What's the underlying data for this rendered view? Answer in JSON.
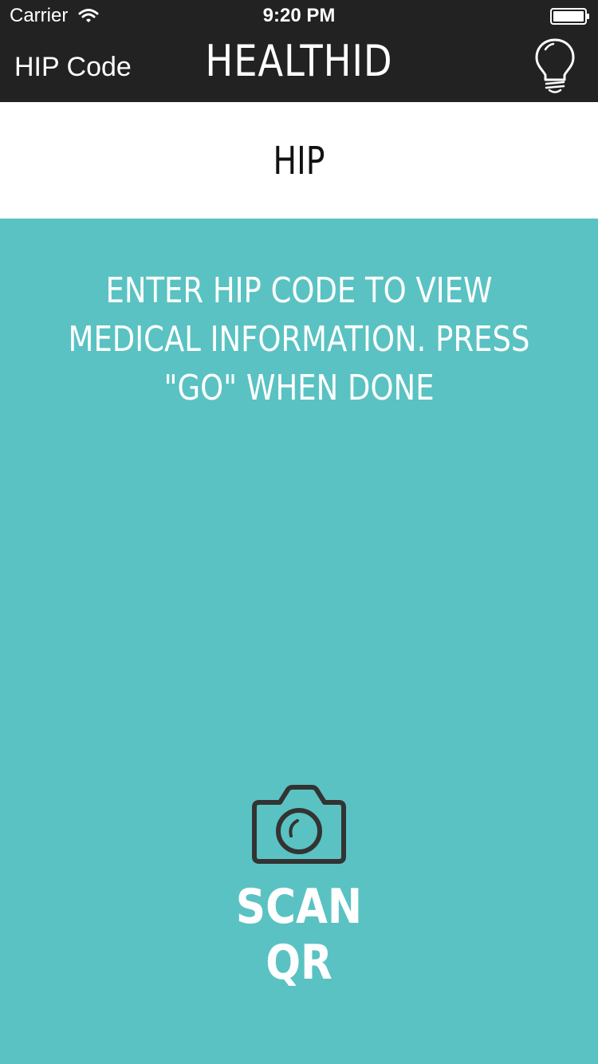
{
  "status_bar": {
    "carrier": "Carrier",
    "time": "9:20 PM",
    "icons": [
      "wifi-icon",
      "battery-icon"
    ]
  },
  "nav_bar": {
    "back_label": "HIP Code",
    "title": "HEALTHID",
    "right_icon": "lightbulb-icon"
  },
  "sub_header": {
    "title": "HIP"
  },
  "main": {
    "instructions": "ENTER HIP CODE TO VIEW MEDICAL INFORMATION. PRESS \"GO\" WHEN DONE",
    "code_input_value": "",
    "scan_icon": "camera-icon",
    "scan_label": "SCAN QR"
  },
  "colors": {
    "bar_background": "#222222",
    "accent_teal": "#5ac2c2",
    "header_background": "#ffffff",
    "icon_stroke": "#333333"
  }
}
